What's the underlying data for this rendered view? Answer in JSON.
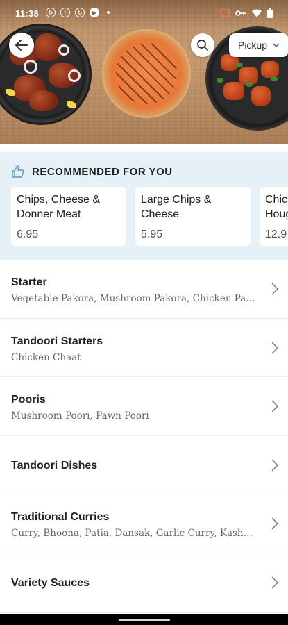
{
  "status_bar": {
    "time": "11:38",
    "icons_left": [
      "sync-icon",
      "info-icon",
      "sync-icon",
      "play-icon",
      "dot"
    ],
    "icons_right": [
      "cast-icon",
      "vpn-key-icon",
      "wifi-icon",
      "battery-icon"
    ]
  },
  "header": {
    "back_icon": "arrow-left-icon",
    "search_icon": "search-icon",
    "pickup_label": "Pickup",
    "pickup_chevron": "chevron-down-icon"
  },
  "recommended": {
    "icon": "thumbs-up-icon",
    "title": "RECOMMENDED FOR YOU",
    "items": [
      {
        "name": "Chips, Cheese & Donner Meat",
        "price": "6.95"
      },
      {
        "name": "Large Chips & Cheese",
        "price": "5.95"
      },
      {
        "name": "Chic Houg",
        "price": "12.9"
      }
    ]
  },
  "categories": [
    {
      "title": "Starter",
      "description": "Vegetable Pakora, Mushroom Pakora, Chicken Pakora,..."
    },
    {
      "title": "Tandoori Starters",
      "description": "Chicken Chaat"
    },
    {
      "title": "Pooris",
      "description": "Mushroom Poori, Pawn Poori"
    },
    {
      "title": "Tandoori Dishes",
      "description": ""
    },
    {
      "title": "Traditional Curries",
      "description": "Curry, Bhoona, Patia, Dansak, Garlic Curry, Kashmiri,..."
    },
    {
      "title": "Variety Sauces",
      "description": ""
    }
  ],
  "colors": {
    "recommended_bg": "#e5f1f7",
    "accent_blue": "#5b9ac4",
    "hero_wood": "#b48961"
  }
}
